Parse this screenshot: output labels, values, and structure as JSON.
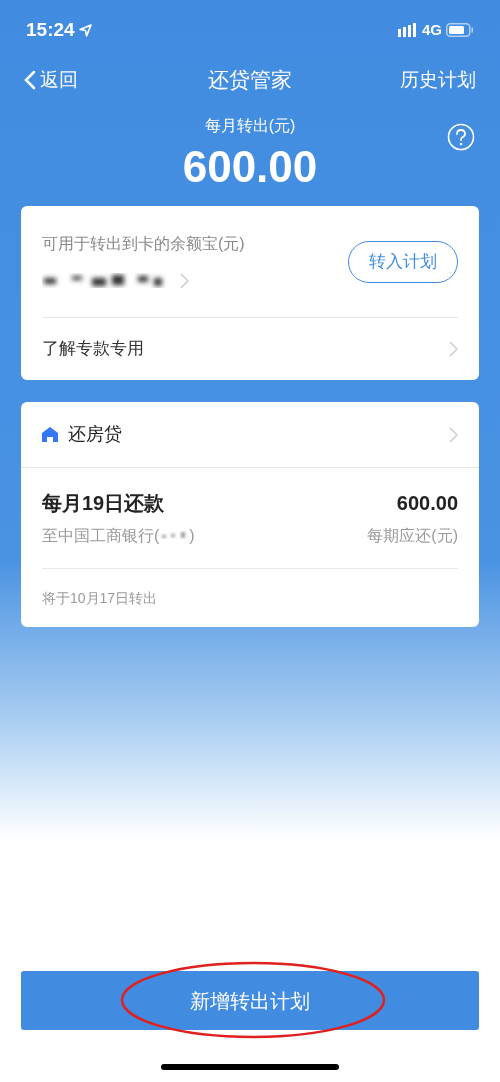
{
  "status_bar": {
    "time": "15:24",
    "network": "4G"
  },
  "nav": {
    "back": "返回",
    "title": "还贷管家",
    "action": "历史计划"
  },
  "summary": {
    "label": "每月转出(元)",
    "amount": "600.00"
  },
  "balance_card": {
    "label": "可用于转出到卡的余额宝(元)",
    "button": "转入计划",
    "link": "了解专款专用"
  },
  "plan_card": {
    "title": "还房贷",
    "due": "每月19日还款",
    "bank": "至中国工商银行(",
    "bank_end": ")",
    "amount": "600.00",
    "amount_label": "每期应还(元)",
    "note": "将于10月17日转出"
  },
  "primary_button": "新增转出计划"
}
